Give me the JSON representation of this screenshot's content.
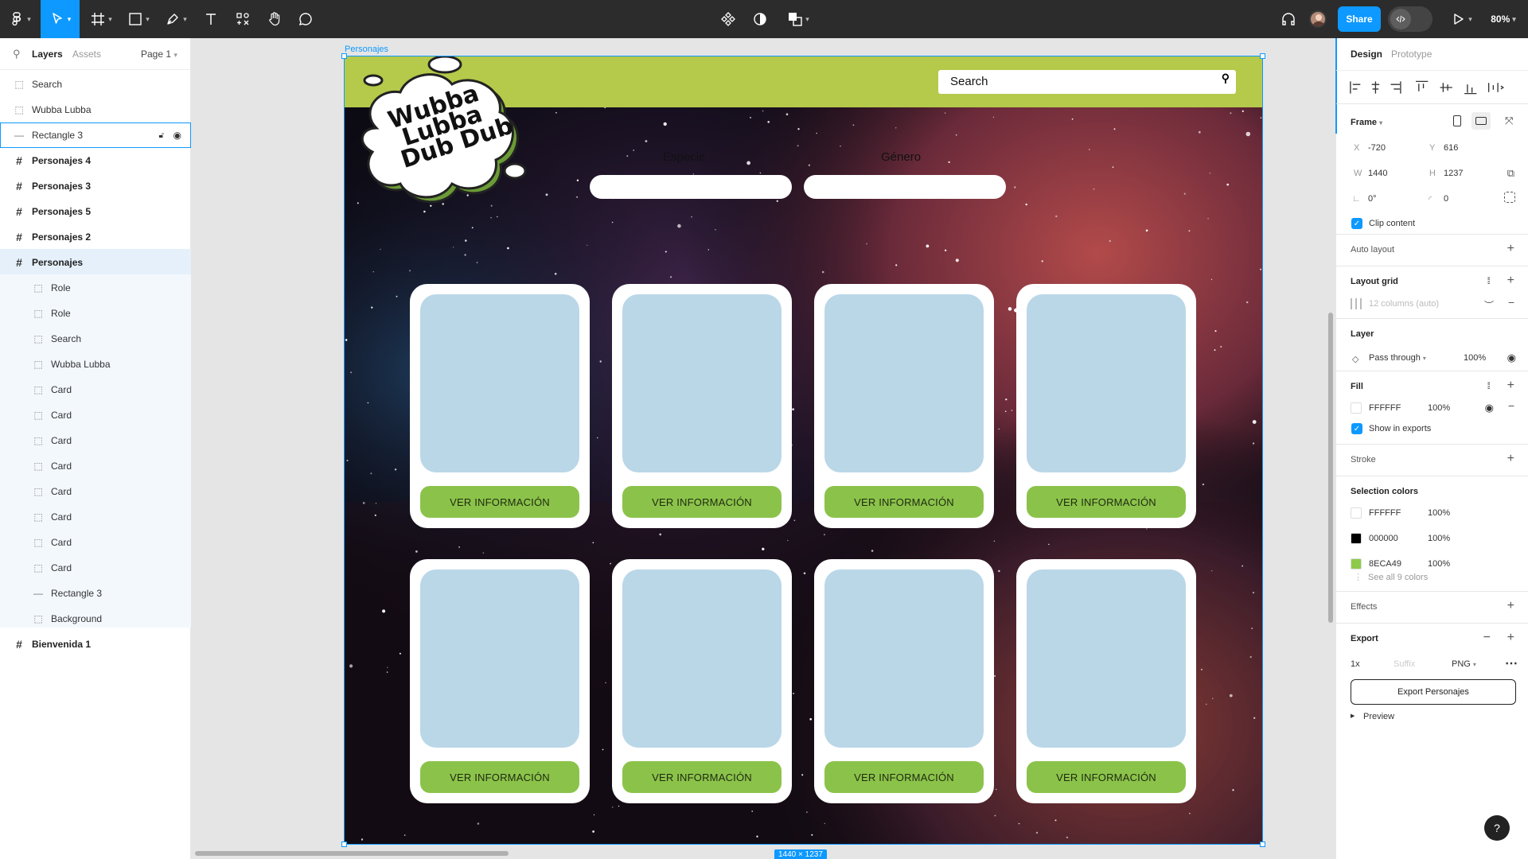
{
  "toolbar": {
    "zoom": "80%",
    "share_label": "Share"
  },
  "left_panel": {
    "tabs": [
      "Layers",
      "Assets"
    ],
    "page_label": "Page 1",
    "layers": [
      {
        "name": "Search",
        "icon": "dashed-frame-icon"
      },
      {
        "name": "Wubba Lubba",
        "icon": "dashed-frame-icon"
      },
      {
        "name": "Rectangle 3",
        "icon": "line-icon"
      },
      {
        "name": "Personajes 4",
        "icon": "frame-icon"
      },
      {
        "name": "Personajes 3",
        "icon": "frame-icon"
      },
      {
        "name": "Personajes 5",
        "icon": "frame-icon"
      },
      {
        "name": "Personajes 2",
        "icon": "frame-icon"
      },
      {
        "name": "Personajes",
        "icon": "frame-icon"
      },
      {
        "name": "Role",
        "icon": "dashed-frame-icon"
      },
      {
        "name": "Role",
        "icon": "dashed-frame-icon"
      },
      {
        "name": "Search",
        "icon": "dashed-frame-icon"
      },
      {
        "name": "Wubba Lubba",
        "icon": "dashed-frame-icon"
      },
      {
        "name": "Card",
        "icon": "dashed-frame-icon"
      },
      {
        "name": "Card",
        "icon": "dashed-frame-icon"
      },
      {
        "name": "Card",
        "icon": "dashed-frame-icon"
      },
      {
        "name": "Card",
        "icon": "dashed-frame-icon"
      },
      {
        "name": "Card",
        "icon": "dashed-frame-icon"
      },
      {
        "name": "Card",
        "icon": "dashed-frame-icon"
      },
      {
        "name": "Card",
        "icon": "dashed-frame-icon"
      },
      {
        "name": "Card",
        "icon": "dashed-frame-icon"
      },
      {
        "name": "Rectangle 3",
        "icon": "line-icon"
      },
      {
        "name": "Background",
        "icon": "dashed-frame-icon"
      },
      {
        "name": "Bienvenida 1",
        "icon": "frame-icon"
      }
    ]
  },
  "canvas": {
    "frame_label": "Personajes",
    "size_badge": "1440 × 1237",
    "search_placeholder": "Search",
    "logo_text": [
      "Wubba",
      "Lubba",
      "Dub Dub"
    ],
    "filter_label_1": "Especie",
    "filter_label_2": "Género",
    "card_button": "VER INFORMACIÓN"
  },
  "right_panel": {
    "tabs": [
      "Design",
      "Prototype"
    ],
    "frame_title": "Frame",
    "x_label": "X",
    "x_value": "-720",
    "y_label": "Y",
    "y_value": "616",
    "w_label": "W",
    "w_value": "1440",
    "h_label": "H",
    "h_value": "1237",
    "rotation": "0°",
    "radius": "0",
    "clip_content": "Clip content",
    "auto_layout": "Auto layout",
    "layout_grid": "Layout grid",
    "grid_desc": "12 columns (auto)",
    "layer": "Layer",
    "blend": "Pass through",
    "opacity": "100%",
    "fill": "Fill",
    "fill_hex": "FFFFFF",
    "fill_opacity": "100%",
    "show_exports": "Show in exports",
    "stroke": "Stroke",
    "selection_colors": "Selection colors",
    "colors": [
      {
        "hex": "FFFFFF",
        "opacity": "100%",
        "swatch": "#FFFFFF"
      },
      {
        "hex": "000000",
        "opacity": "100%",
        "swatch": "#000000"
      },
      {
        "hex": "8ECA49",
        "opacity": "100%",
        "swatch": "#8ECA49"
      }
    ],
    "see_all": "See all 9 colors",
    "effects": "Effects",
    "export": "Export",
    "export_scale": "1x",
    "export_suffix": "Suffix",
    "export_format": "PNG",
    "export_button": "Export Personajes",
    "preview": "Preview"
  },
  "colors": {
    "accent": "#0d99ff",
    "header_green": "#b5c94a",
    "button_green": "#8bc34a",
    "card_image": "#bad7e8"
  }
}
